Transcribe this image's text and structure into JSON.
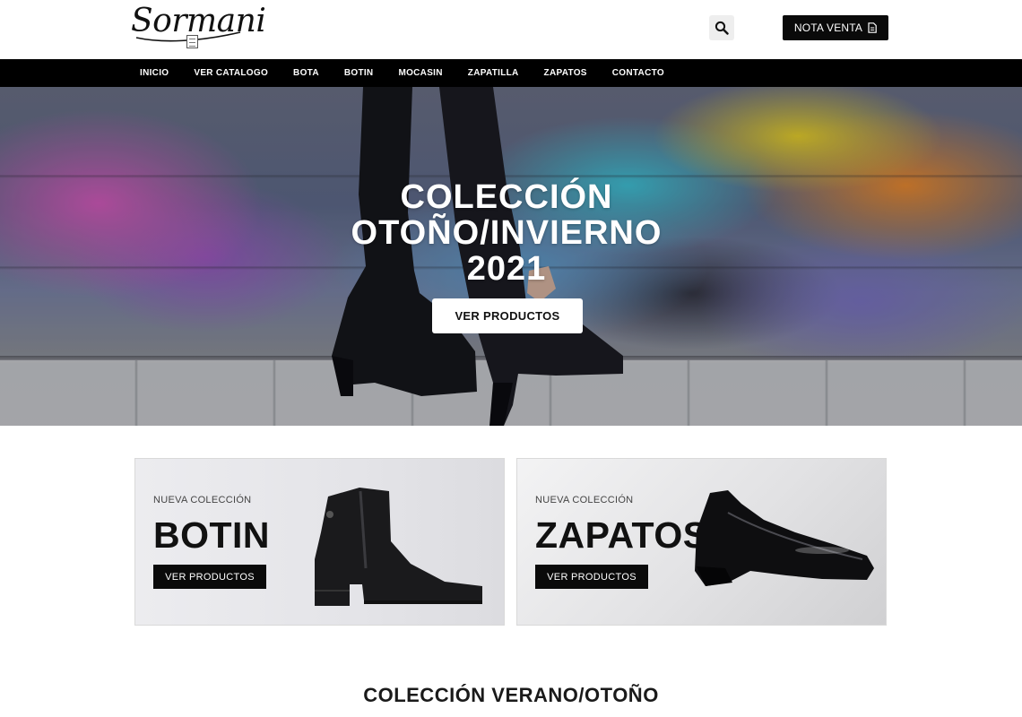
{
  "header": {
    "logo_text": "Sormani",
    "nota_label": "NOTA VENTA"
  },
  "nav": {
    "items": [
      "INICIO",
      "VER CATALOGO",
      "BOTA",
      "BOTIN",
      "MOCASIN",
      "ZAPATILLA",
      "ZAPATOS",
      "CONTACTO"
    ]
  },
  "hero": {
    "title_lines": [
      "COLECCIÓN",
      "OTOÑO/INVIERNO",
      "2021"
    ],
    "button_label": "VER PRODUCTOS"
  },
  "cards": [
    {
      "subtitle": "NUEVA COLECCIÓN",
      "title": "BOTIN",
      "button_label": "VER PRODUCTOS"
    },
    {
      "subtitle": "NUEVA COLECCIÓN",
      "title": "ZAPATOS",
      "button_label": "VER PRODUCTOS"
    }
  ],
  "section": {
    "title": "COLECCIÓN VERANO/OTOÑO"
  },
  "colors": {
    "nav_bg": "#000000",
    "button_dark": "#0a0a0a",
    "search_bg": "#eeeeee"
  }
}
